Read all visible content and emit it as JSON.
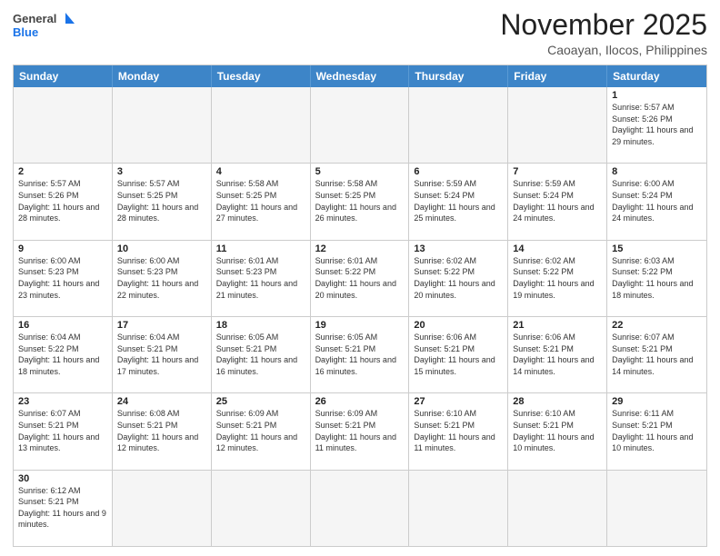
{
  "header": {
    "logo_general": "General",
    "logo_blue": "Blue",
    "month": "November 2025",
    "location": "Caoayan, Ilocos, Philippines"
  },
  "weekdays": [
    "Sunday",
    "Monday",
    "Tuesday",
    "Wednesday",
    "Thursday",
    "Friday",
    "Saturday"
  ],
  "rows": [
    [
      {
        "day": "",
        "sunrise": "",
        "sunset": "",
        "daylight": ""
      },
      {
        "day": "",
        "sunrise": "",
        "sunset": "",
        "daylight": ""
      },
      {
        "day": "",
        "sunrise": "",
        "sunset": "",
        "daylight": ""
      },
      {
        "day": "",
        "sunrise": "",
        "sunset": "",
        "daylight": ""
      },
      {
        "day": "",
        "sunrise": "",
        "sunset": "",
        "daylight": ""
      },
      {
        "day": "",
        "sunrise": "",
        "sunset": "",
        "daylight": ""
      },
      {
        "day": "1",
        "sunrise": "Sunrise: 5:57 AM",
        "sunset": "Sunset: 5:26 PM",
        "daylight": "Daylight: 11 hours and 29 minutes."
      }
    ],
    [
      {
        "day": "2",
        "sunrise": "Sunrise: 5:57 AM",
        "sunset": "Sunset: 5:26 PM",
        "daylight": "Daylight: 11 hours and 28 minutes."
      },
      {
        "day": "3",
        "sunrise": "Sunrise: 5:57 AM",
        "sunset": "Sunset: 5:25 PM",
        "daylight": "Daylight: 11 hours and 28 minutes."
      },
      {
        "day": "4",
        "sunrise": "Sunrise: 5:58 AM",
        "sunset": "Sunset: 5:25 PM",
        "daylight": "Daylight: 11 hours and 27 minutes."
      },
      {
        "day": "5",
        "sunrise": "Sunrise: 5:58 AM",
        "sunset": "Sunset: 5:25 PM",
        "daylight": "Daylight: 11 hours and 26 minutes."
      },
      {
        "day": "6",
        "sunrise": "Sunrise: 5:59 AM",
        "sunset": "Sunset: 5:24 PM",
        "daylight": "Daylight: 11 hours and 25 minutes."
      },
      {
        "day": "7",
        "sunrise": "Sunrise: 5:59 AM",
        "sunset": "Sunset: 5:24 PM",
        "daylight": "Daylight: 11 hours and 24 minutes."
      },
      {
        "day": "8",
        "sunrise": "Sunrise: 6:00 AM",
        "sunset": "Sunset: 5:24 PM",
        "daylight": "Daylight: 11 hours and 24 minutes."
      }
    ],
    [
      {
        "day": "9",
        "sunrise": "Sunrise: 6:00 AM",
        "sunset": "Sunset: 5:23 PM",
        "daylight": "Daylight: 11 hours and 23 minutes."
      },
      {
        "day": "10",
        "sunrise": "Sunrise: 6:00 AM",
        "sunset": "Sunset: 5:23 PM",
        "daylight": "Daylight: 11 hours and 22 minutes."
      },
      {
        "day": "11",
        "sunrise": "Sunrise: 6:01 AM",
        "sunset": "Sunset: 5:23 PM",
        "daylight": "Daylight: 11 hours and 21 minutes."
      },
      {
        "day": "12",
        "sunrise": "Sunrise: 6:01 AM",
        "sunset": "Sunset: 5:22 PM",
        "daylight": "Daylight: 11 hours and 20 minutes."
      },
      {
        "day": "13",
        "sunrise": "Sunrise: 6:02 AM",
        "sunset": "Sunset: 5:22 PM",
        "daylight": "Daylight: 11 hours and 20 minutes."
      },
      {
        "day": "14",
        "sunrise": "Sunrise: 6:02 AM",
        "sunset": "Sunset: 5:22 PM",
        "daylight": "Daylight: 11 hours and 19 minutes."
      },
      {
        "day": "15",
        "sunrise": "Sunrise: 6:03 AM",
        "sunset": "Sunset: 5:22 PM",
        "daylight": "Daylight: 11 hours and 18 minutes."
      }
    ],
    [
      {
        "day": "16",
        "sunrise": "Sunrise: 6:04 AM",
        "sunset": "Sunset: 5:22 PM",
        "daylight": "Daylight: 11 hours and 18 minutes."
      },
      {
        "day": "17",
        "sunrise": "Sunrise: 6:04 AM",
        "sunset": "Sunset: 5:21 PM",
        "daylight": "Daylight: 11 hours and 17 minutes."
      },
      {
        "day": "18",
        "sunrise": "Sunrise: 6:05 AM",
        "sunset": "Sunset: 5:21 PM",
        "daylight": "Daylight: 11 hours and 16 minutes."
      },
      {
        "day": "19",
        "sunrise": "Sunrise: 6:05 AM",
        "sunset": "Sunset: 5:21 PM",
        "daylight": "Daylight: 11 hours and 16 minutes."
      },
      {
        "day": "20",
        "sunrise": "Sunrise: 6:06 AM",
        "sunset": "Sunset: 5:21 PM",
        "daylight": "Daylight: 11 hours and 15 minutes."
      },
      {
        "day": "21",
        "sunrise": "Sunrise: 6:06 AM",
        "sunset": "Sunset: 5:21 PM",
        "daylight": "Daylight: 11 hours and 14 minutes."
      },
      {
        "day": "22",
        "sunrise": "Sunrise: 6:07 AM",
        "sunset": "Sunset: 5:21 PM",
        "daylight": "Daylight: 11 hours and 14 minutes."
      }
    ],
    [
      {
        "day": "23",
        "sunrise": "Sunrise: 6:07 AM",
        "sunset": "Sunset: 5:21 PM",
        "daylight": "Daylight: 11 hours and 13 minutes."
      },
      {
        "day": "24",
        "sunrise": "Sunrise: 6:08 AM",
        "sunset": "Sunset: 5:21 PM",
        "daylight": "Daylight: 11 hours and 12 minutes."
      },
      {
        "day": "25",
        "sunrise": "Sunrise: 6:09 AM",
        "sunset": "Sunset: 5:21 PM",
        "daylight": "Daylight: 11 hours and 12 minutes."
      },
      {
        "day": "26",
        "sunrise": "Sunrise: 6:09 AM",
        "sunset": "Sunset: 5:21 PM",
        "daylight": "Daylight: 11 hours and 11 minutes."
      },
      {
        "day": "27",
        "sunrise": "Sunrise: 6:10 AM",
        "sunset": "Sunset: 5:21 PM",
        "daylight": "Daylight: 11 hours and 11 minutes."
      },
      {
        "day": "28",
        "sunrise": "Sunrise: 6:10 AM",
        "sunset": "Sunset: 5:21 PM",
        "daylight": "Daylight: 11 hours and 10 minutes."
      },
      {
        "day": "29",
        "sunrise": "Sunrise: 6:11 AM",
        "sunset": "Sunset: 5:21 PM",
        "daylight": "Daylight: 11 hours and 10 minutes."
      }
    ],
    [
      {
        "day": "30",
        "sunrise": "Sunrise: 6:12 AM",
        "sunset": "Sunset: 5:21 PM",
        "daylight": "Daylight: 11 hours and 9 minutes."
      },
      {
        "day": "",
        "sunrise": "",
        "sunset": "",
        "daylight": ""
      },
      {
        "day": "",
        "sunrise": "",
        "sunset": "",
        "daylight": ""
      },
      {
        "day": "",
        "sunrise": "",
        "sunset": "",
        "daylight": ""
      },
      {
        "day": "",
        "sunrise": "",
        "sunset": "",
        "daylight": ""
      },
      {
        "day": "",
        "sunrise": "",
        "sunset": "",
        "daylight": ""
      },
      {
        "day": "",
        "sunrise": "",
        "sunset": "",
        "daylight": ""
      }
    ]
  ]
}
